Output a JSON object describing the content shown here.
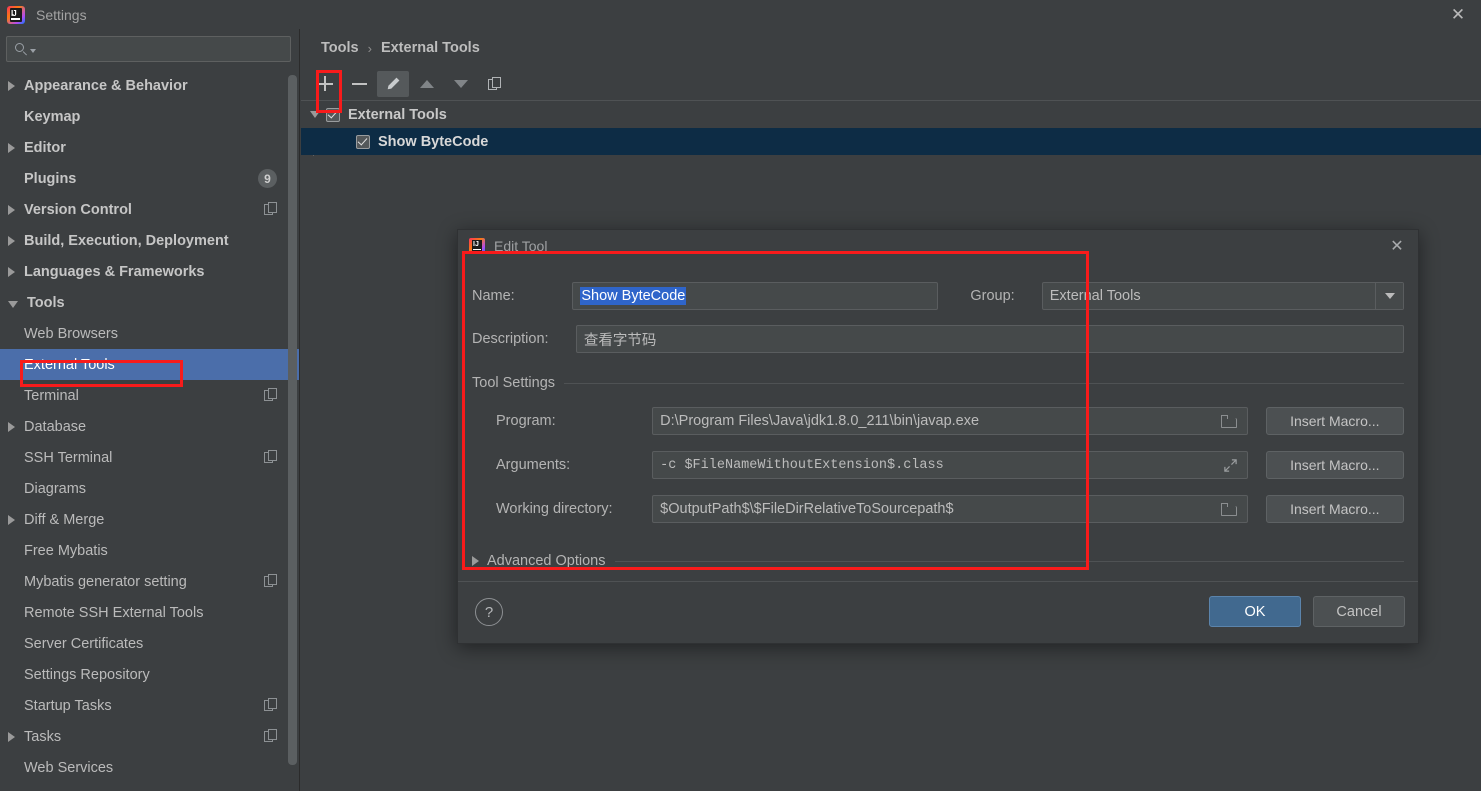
{
  "window": {
    "title": "Settings",
    "logo_icon": "intellij-idea-logo",
    "close_icon": "✕"
  },
  "sidebar": {
    "search": {
      "placeholder": "",
      "value": "",
      "icon": "search-icon"
    },
    "items": [
      {
        "label": "Appearance & Behavior",
        "level": 1,
        "arrow": "right",
        "bold": true
      },
      {
        "label": "Keymap",
        "level": 1,
        "arrow": "none",
        "bold": true
      },
      {
        "label": "Editor",
        "level": 1,
        "arrow": "right",
        "bold": true
      },
      {
        "label": "Plugins",
        "level": 1,
        "arrow": "none",
        "bold": true,
        "badge": "9"
      },
      {
        "label": "Version Control",
        "level": 1,
        "arrow": "right",
        "bold": true,
        "copy": true
      },
      {
        "label": "Build, Execution, Deployment",
        "level": 1,
        "arrow": "right",
        "bold": true
      },
      {
        "label": "Languages & Frameworks",
        "level": 1,
        "arrow": "right",
        "bold": true
      },
      {
        "label": "Tools",
        "level": 1,
        "arrow": "down",
        "bold": true
      },
      {
        "label": "Web Browsers",
        "level": 2,
        "arrow": "none",
        "bold": false
      },
      {
        "label": "External Tools",
        "level": 2,
        "arrow": "none",
        "bold": false,
        "selected": true
      },
      {
        "label": "Terminal",
        "level": 2,
        "arrow": "none",
        "bold": false,
        "copy": true
      },
      {
        "label": "Database",
        "level": 2,
        "arrow": "right",
        "bold": false
      },
      {
        "label": "SSH Terminal",
        "level": 2,
        "arrow": "none",
        "bold": false,
        "copy": true
      },
      {
        "label": "Diagrams",
        "level": 2,
        "arrow": "none",
        "bold": false
      },
      {
        "label": "Diff & Merge",
        "level": 2,
        "arrow": "right",
        "bold": false
      },
      {
        "label": "Free Mybatis",
        "level": 2,
        "arrow": "none",
        "bold": false
      },
      {
        "label": "Mybatis generator setting",
        "level": 2,
        "arrow": "none",
        "bold": false,
        "copy": true
      },
      {
        "label": "Remote SSH External Tools",
        "level": 2,
        "arrow": "none",
        "bold": false
      },
      {
        "label": "Server Certificates",
        "level": 2,
        "arrow": "none",
        "bold": false
      },
      {
        "label": "Settings Repository",
        "level": 2,
        "arrow": "none",
        "bold": false
      },
      {
        "label": "Startup Tasks",
        "level": 2,
        "arrow": "none",
        "bold": false,
        "copy": true
      },
      {
        "label": "Tasks",
        "level": 2,
        "arrow": "right",
        "bold": false,
        "copy": true
      },
      {
        "label": "Web Services",
        "level": 2,
        "arrow": "none",
        "bold": false
      }
    ]
  },
  "main": {
    "breadcrumb": {
      "root": "Tools",
      "separator": "›",
      "current": "External Tools"
    },
    "toolbar": {
      "add": "add-icon",
      "remove": "remove-icon",
      "edit": "edit-pencil-icon",
      "move_up": "move-up-icon",
      "move_down": "move-down-icon",
      "copy": "copy-icon"
    },
    "tool_tree": [
      {
        "label": "External Tools",
        "checked": true,
        "level": 0,
        "expanded": true
      },
      {
        "label": "Show ByteCode",
        "checked": true,
        "level": 1,
        "selected": true
      }
    ]
  },
  "dialog": {
    "title": "Edit Tool",
    "logo_icon": "intellij-idea-logo",
    "close_icon": "✕",
    "fields": {
      "name_label": "Name:",
      "name_value": "Show ByteCode",
      "group_label": "Group:",
      "group_value": "External Tools",
      "description_label": "Description:",
      "description_value": "查看字节码"
    },
    "tool_settings": {
      "title": "Tool Settings",
      "program_label": "Program:",
      "program_value": "D:\\Program Files\\Java\\jdk1.8.0_211\\bin\\javap.exe",
      "arguments_label": "Arguments:",
      "arguments_value": "-c $FileNameWithoutExtension$.class",
      "working_dir_label": "Working directory:",
      "working_dir_value": "$OutputPath$\\$FileDirRelativeToSourcepath$",
      "insert_macro_label": "Insert Macro..."
    },
    "advanced_options": {
      "label": "Advanced Options",
      "expanded": false
    },
    "footer": {
      "help_label": "?",
      "ok_label": "OK",
      "cancel_label": "Cancel"
    }
  },
  "annotations": {
    "accent_color": "#f81b1b",
    "boxes": [
      "add-button",
      "sidebar-external-tools",
      "edit-tool-form-area"
    ]
  },
  "colors": {
    "background": "#3c3f41",
    "sidebar_selection": "#4b6eaa",
    "tree_selection": "#0d2c45",
    "field_background": "#45494a",
    "ok_button": "#41698f",
    "text_selection": "#2f65ca"
  }
}
